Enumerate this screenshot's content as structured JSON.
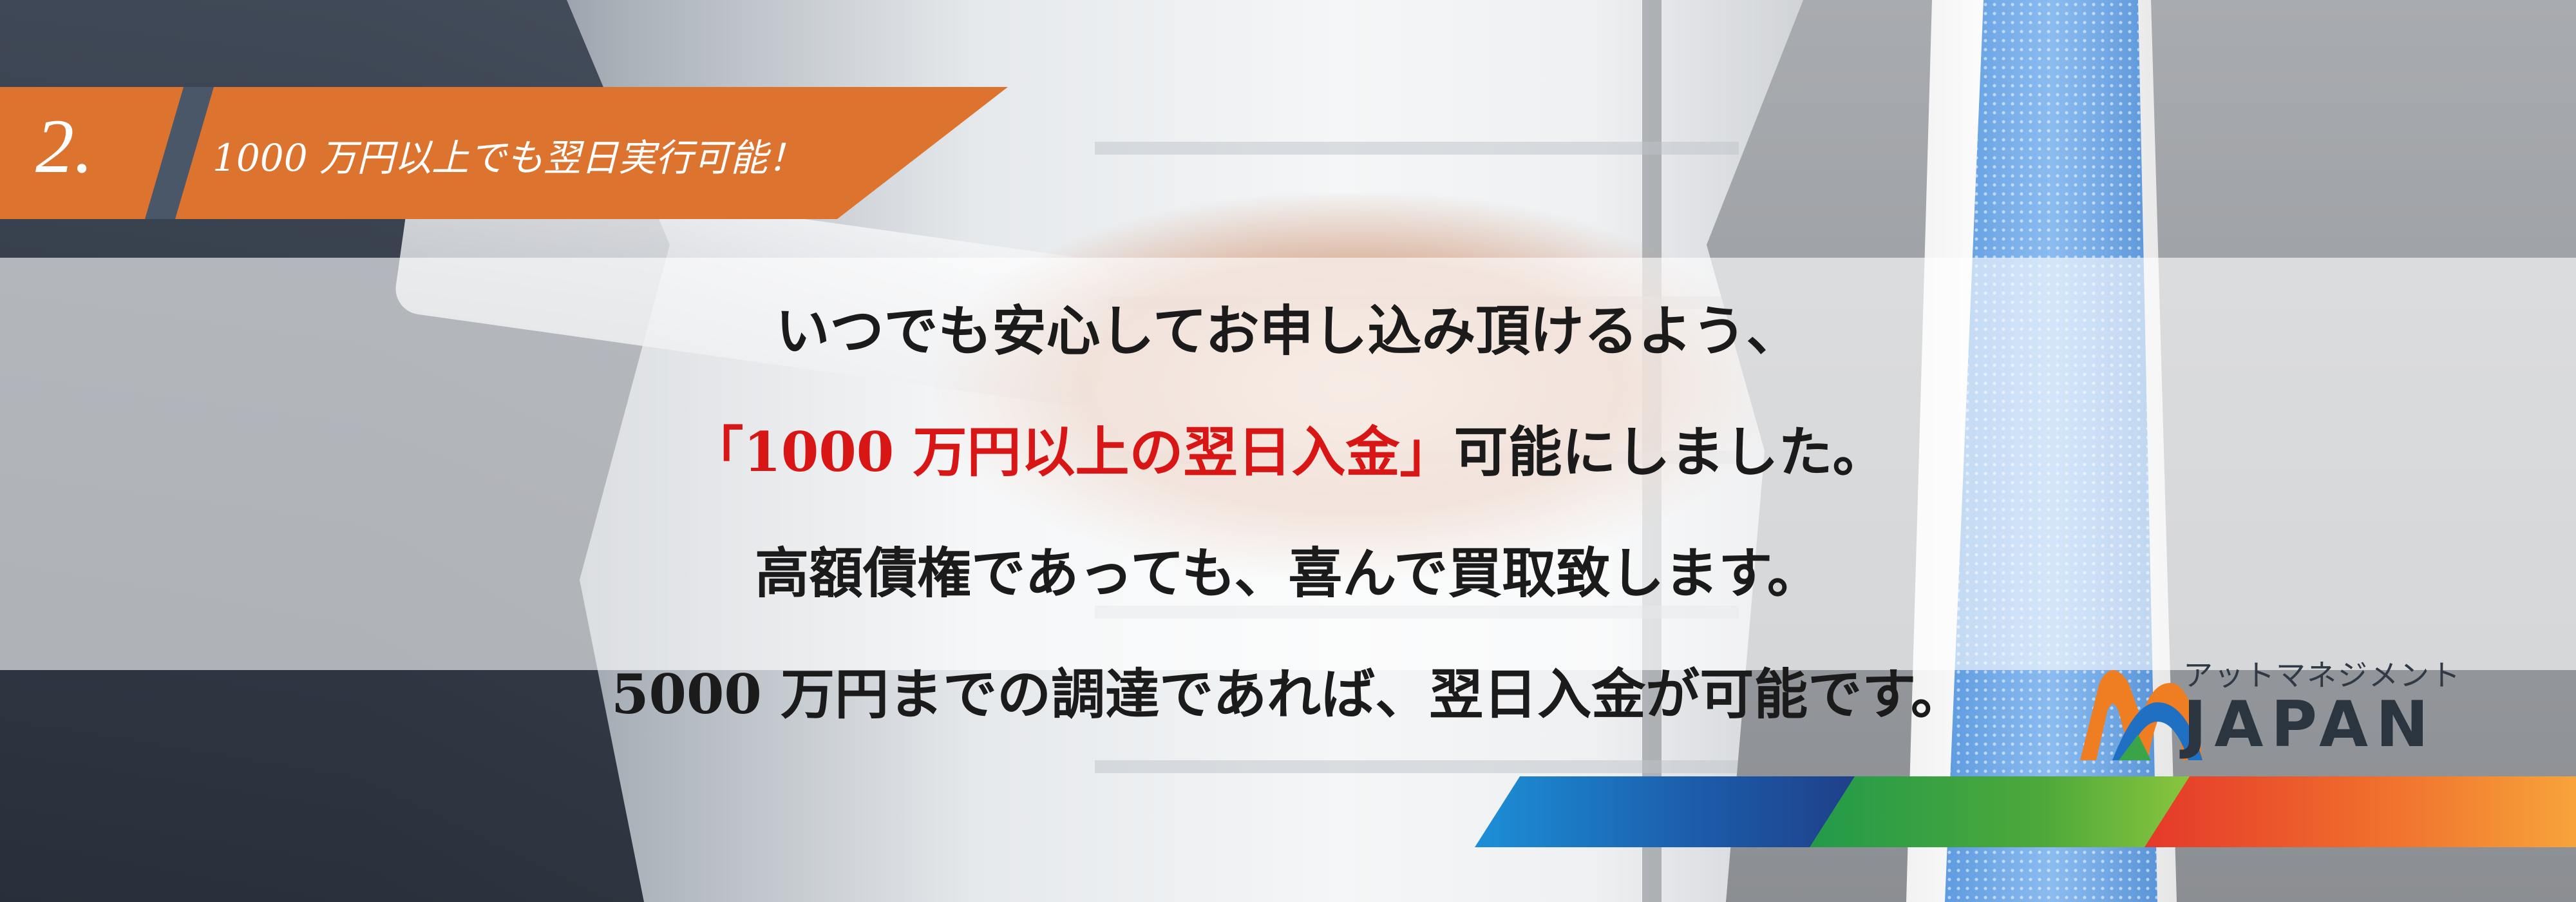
{
  "ribbon": {
    "number": "2.",
    "headline": "1000 万円以上でも翌日実行可能！"
  },
  "message": {
    "line1": "いつでも安心してお申し込み頂けるよう、",
    "line2_highlight": "「1000 万円以上の翌日入金」",
    "line2_rest": "可能にしました。",
    "line3": "高額債権であっても、喜んで買取致します。",
    "line4": "5000 万円までの調達であれば、翌日入金が可能です。"
  },
  "logo": {
    "kana": "アットマネジメント",
    "word": "JAPAN"
  },
  "colors": {
    "ribbon_orange": "#dc7430",
    "ribbon_dark": "#4a5768",
    "highlight_red": "#d81616",
    "bar_blue": "#1c5aa8",
    "bar_green": "#4da83a",
    "bar_orange": "#ef6a2c"
  }
}
